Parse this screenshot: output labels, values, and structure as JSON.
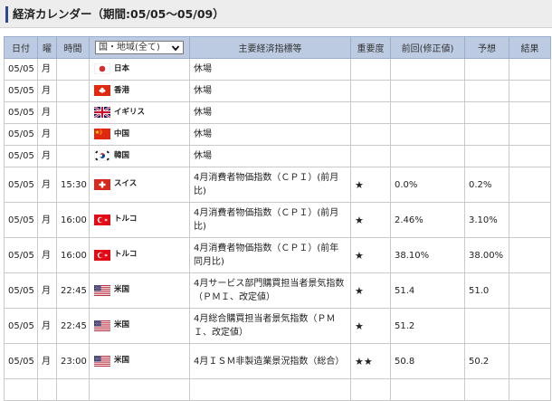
{
  "section": {
    "title": "経済カレンダー（期間:05/05〜05/09）"
  },
  "table": {
    "headers": {
      "date": "日付",
      "weekday": "曜",
      "time": "時間",
      "country_select": "国・地域(全て)",
      "indicator": "主要経済指標等",
      "importance": "重要度",
      "previous": "前回(修正値)",
      "forecast": "予想",
      "result": "結果"
    },
    "rows": [
      {
        "date": "05/05",
        "weekday": "月",
        "time": "",
        "flag": "japan",
        "country": "日本",
        "indicator": "休場",
        "importance": "",
        "previous": "",
        "forecast": "",
        "result": ""
      },
      {
        "date": "05/05",
        "weekday": "月",
        "time": "",
        "flag": "hongkong",
        "country": "香港",
        "indicator": "休場",
        "importance": "",
        "previous": "",
        "forecast": "",
        "result": ""
      },
      {
        "date": "05/05",
        "weekday": "月",
        "time": "",
        "flag": "uk",
        "country": "イギリス",
        "indicator": "休場",
        "importance": "",
        "previous": "",
        "forecast": "",
        "result": ""
      },
      {
        "date": "05/05",
        "weekday": "月",
        "time": "",
        "flag": "china",
        "country": "中国",
        "indicator": "休場",
        "importance": "",
        "previous": "",
        "forecast": "",
        "result": ""
      },
      {
        "date": "05/05",
        "weekday": "月",
        "time": "",
        "flag": "korea",
        "country": "韓国",
        "indicator": "休場",
        "importance": "",
        "previous": "",
        "forecast": "",
        "result": ""
      },
      {
        "date": "05/05",
        "weekday": "月",
        "time": "15:30",
        "flag": "switzerland",
        "country": "スイス",
        "indicator": "4月消費者物価指数（ＣＰＩ）(前月比)",
        "importance": "★",
        "previous": "0.0%",
        "forecast": "0.2%",
        "result": ""
      },
      {
        "date": "05/05",
        "weekday": "月",
        "time": "16:00",
        "flag": "turkey",
        "country": "トルコ",
        "indicator": "4月消費者物価指数（ＣＰＩ）(前月比)",
        "importance": "★",
        "previous": "2.46%",
        "forecast": "3.10%",
        "result": ""
      },
      {
        "date": "05/05",
        "weekday": "月",
        "time": "16:00",
        "flag": "turkey",
        "country": "トルコ",
        "indicator": "4月消費者物価指数（ＣＰＩ）(前年同月比)",
        "importance": "★",
        "previous": "38.10%",
        "forecast": "38.00%",
        "result": ""
      },
      {
        "date": "05/05",
        "weekday": "月",
        "time": "22:45",
        "flag": "usa",
        "country": "米国",
        "indicator": "4月サービス部門購買担当者景気指数（ＰＭＩ、改定値）",
        "importance": "★",
        "previous": "51.4",
        "forecast": "51.0",
        "result": ""
      },
      {
        "date": "05/05",
        "weekday": "月",
        "time": "22:45",
        "flag": "usa",
        "country": "米国",
        "indicator": "4月総合購買担当者景気指数（ＰＭＩ、改定値）",
        "importance": "★",
        "previous": "51.2",
        "forecast": "",
        "result": ""
      },
      {
        "date": "05/05",
        "weekday": "月",
        "time": "23:00",
        "flag": "usa",
        "country": "米国",
        "indicator": "4月ＩＳＭ非製造業景況指数（総合）",
        "importance": "★★",
        "previous": "50.8",
        "forecast": "50.2",
        "result": ""
      }
    ]
  },
  "colors": {
    "header_bg": "#bccbe2",
    "section_accent": "#2e4a8e",
    "section_bg": "#ededed"
  }
}
